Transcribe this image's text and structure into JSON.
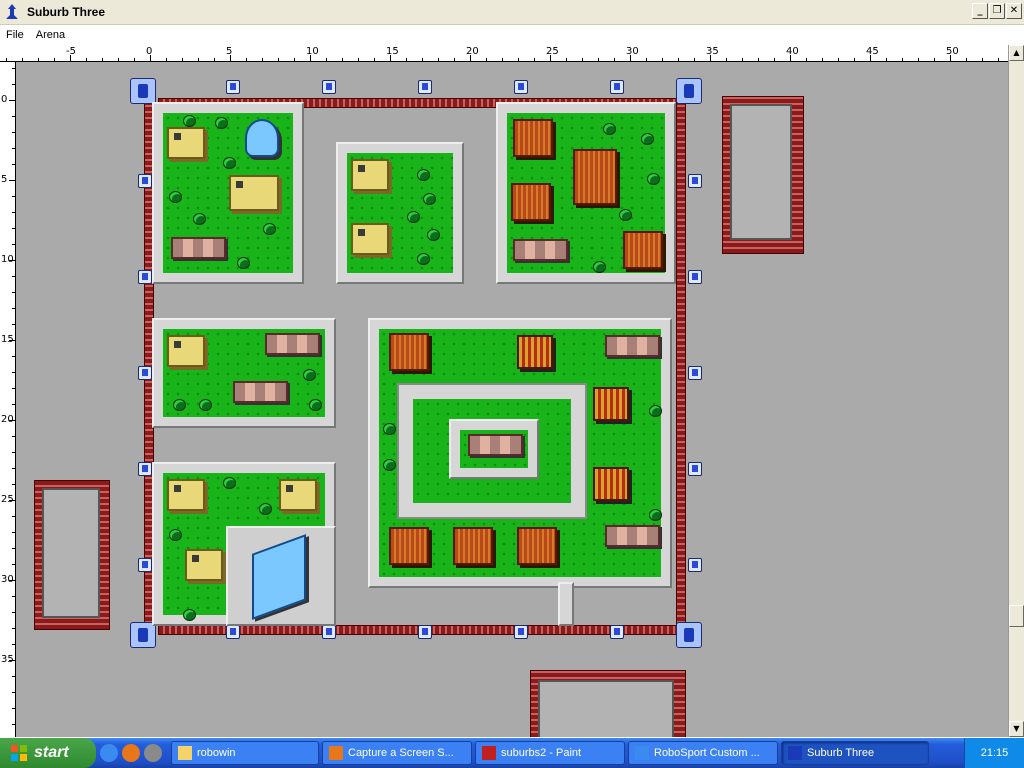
{
  "window": {
    "title": "Suburb Three"
  },
  "menu": [
    "File",
    "Arena"
  ],
  "ruler": {
    "x_labels": [
      "-5",
      "0",
      "5",
      "10",
      "15",
      "20",
      "25",
      "30",
      "35",
      "40",
      "45",
      "50"
    ],
    "y_labels": [
      "0",
      "5",
      "10",
      "15",
      "20",
      "25",
      "30",
      "35"
    ]
  },
  "scrollbar": {
    "up_arrow_icon": "up-arrow-icon",
    "down_arrow_icon": "down-arrow-icon"
  },
  "taskbar": {
    "start_label": "start",
    "quick_launch": [
      "ie-icon",
      "firefox-icon",
      "misc-icon"
    ],
    "tasks": [
      {
        "label": "robowin",
        "icon": "folder-icon",
        "active": false
      },
      {
        "label": "Capture a Screen S...",
        "icon": "firefox-icon",
        "active": false
      },
      {
        "label": "suburbs2 - Paint",
        "icon": "paint-icon",
        "active": false
      },
      {
        "label": "RoboSport Custom ...",
        "icon": "window-icon",
        "active": false
      },
      {
        "label": "Suburb Three",
        "icon": "robot-icon",
        "active": true
      }
    ],
    "clock": "21:15"
  },
  "colors": {
    "grass": "#19b419",
    "arena_bg": "#aaaaaa",
    "wall": "#8b1a1a",
    "taskbar": "#245edb"
  }
}
